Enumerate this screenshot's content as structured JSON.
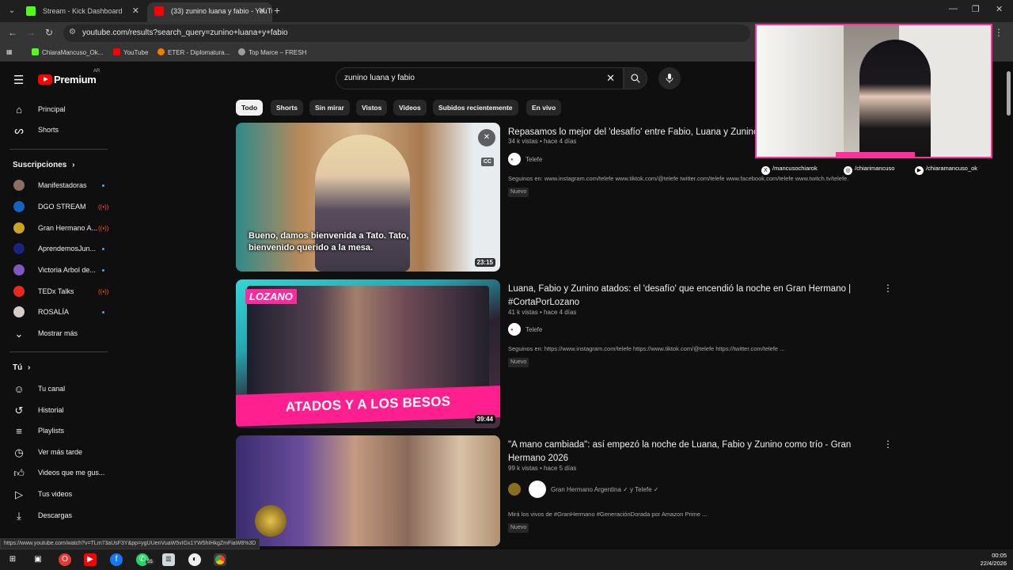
{
  "browser": {
    "tabs": [
      {
        "label": "Stream - Kick Dashboard",
        "favicon_color": "#53fc18",
        "active": false
      },
      {
        "label": "(33) zunino luana y fabio - YouTu...",
        "favicon_color": "#ff0000",
        "active": true
      }
    ],
    "url": "youtube.com/results?search_query=zunino+luana+y+fabio",
    "bookmarks": [
      {
        "label": "ChiaraMancuso_Ok...",
        "color": "#53fc18"
      },
      {
        "label": "YouTube",
        "color": "#ff0000"
      },
      {
        "label": "ETER - Diplomatura...",
        "color": "#f57c00"
      },
      {
        "label": "Top Marce – FRESH",
        "color": "#9e9e9e"
      }
    ]
  },
  "header": {
    "logo_text": "Premium",
    "region": "AR",
    "search_query": "zunino luana y fabio"
  },
  "sidebar": {
    "main": [
      {
        "label": "Principal",
        "icon": "home-icon"
      },
      {
        "label": "Shorts",
        "icon": "shorts-icon"
      }
    ],
    "subscriptions_heading": "Suscripciones",
    "subscriptions": [
      {
        "label": "Manifestadoras",
        "color": "#8d6e63",
        "status": "dot"
      },
      {
        "label": "DGO STREAM",
        "color": "#1565c0",
        "status": "live"
      },
      {
        "label": "Gran Hermano A...",
        "color": "#c9a227",
        "status": "live"
      },
      {
        "label": "AprendemosJun...",
        "color": "#1a237e",
        "status": "dot"
      },
      {
        "label": "Victoria Arbol de...",
        "color": "#7e57c2",
        "status": "dot"
      },
      {
        "label": "TEDx Talks",
        "color": "#e62b1e",
        "status": "live"
      },
      {
        "label": "ROSALÍA",
        "color": "#d7ccc8",
        "status": "dot"
      }
    ],
    "show_more": "Mostrar más",
    "you_heading": "Tú",
    "you_items": [
      {
        "label": "Tu canal",
        "icon": "channel-icon"
      },
      {
        "label": "Historial",
        "icon": "history-icon"
      },
      {
        "label": "Playlists",
        "icon": "playlists-icon"
      },
      {
        "label": "Ver más tarde",
        "icon": "clock-icon"
      },
      {
        "label": "Videos que me gus...",
        "icon": "thumbs-up-icon"
      },
      {
        "label": "Tus videos",
        "icon": "play-icon"
      },
      {
        "label": "Descargas",
        "icon": "download-icon"
      }
    ]
  },
  "chips": [
    "Todo",
    "Shorts",
    "Sin mirar",
    "Vistos",
    "Videos",
    "Subidos recientemente",
    "En vivo"
  ],
  "results": [
    {
      "title": "Repasamos lo mejor del 'desafío' entre Fabio, Luana y Zunino",
      "meta": "34 k vistas • hace 4 días",
      "channel": "Telefe",
      "description": "Seguinos en: www.instagram.com/telefe www.tiktok.com/@telefe twitter.com/telefe www.facebook.com/telefe www.twitch.tv/telefe.",
      "badge": "Nuevo",
      "duration": "23:15",
      "caption": "Bueno, damos bienvenida a Tato. Tato, bienvenido querido a la mesa."
    },
    {
      "title": "Luana, Fabio y Zunino atados: el 'desafío' que encendió la noche en Gran Hermano | #CortaPorLozano",
      "meta": "41 k vistas • hace 4 días",
      "channel": "Telefe",
      "description": "Seguinos en: https://www.instagram.com/telefe https://www.tiktok.com/@telefe https://twitter.com/telefe ...",
      "badge": "Nuevo",
      "duration": "39:44",
      "thumb_text": "ATADOS Y A LOS BESOS",
      "thumb_logo": "LOZANO"
    },
    {
      "title": "\"A mano cambiada\": así empezó la noche de Luana, Fabio y Zunino como trío - Gran Hermano 2026",
      "meta": "99 k vistas • hace 5 días",
      "channel": "Gran Hermano Argentina ✓ y Telefe ✓",
      "description": "Mirá los vivos de #GranHermano #GeneraciónDorada por Amazon Prime ...",
      "badge": "Nuevo"
    }
  ],
  "socials": [
    "/mancusochiarok",
    "/chiarimancuso",
    "/chiaramancuso_ok"
  ],
  "status_url": "https://www.youtube.com/watch?v=TLm73aUsF3Y&pp=ygUUenVuaW5vIGx1YW5hIHkgZmFiaW8%3D",
  "taskbar": {
    "time": "00:05",
    "date": "22/4/2026",
    "badge": "55"
  }
}
